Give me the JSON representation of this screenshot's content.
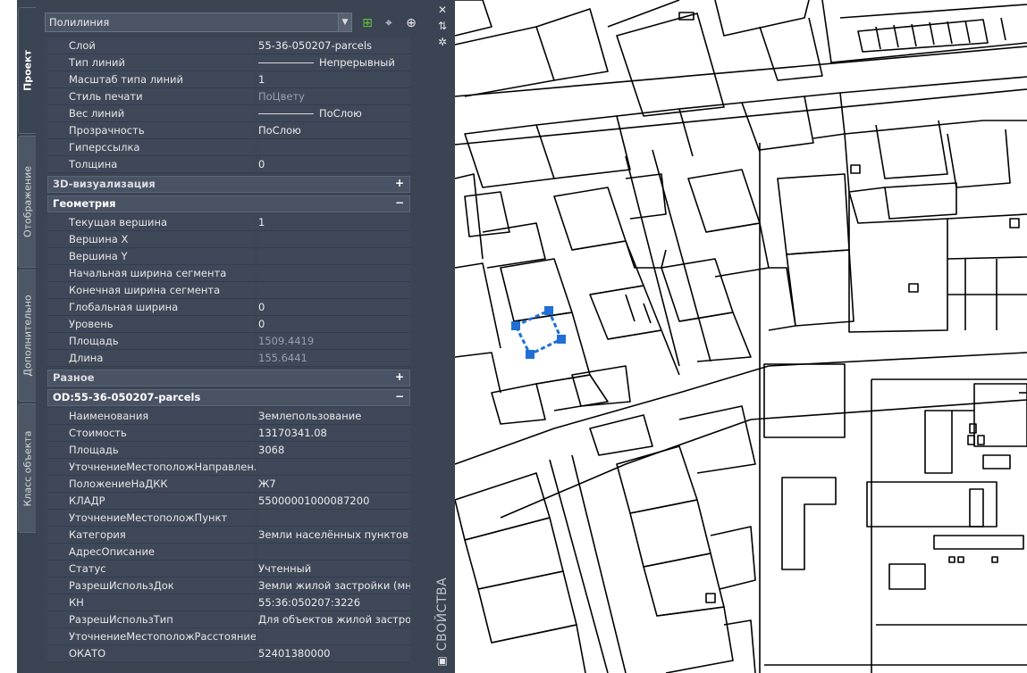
{
  "object_type": "Полилиния",
  "side_tabs": [
    "Проект",
    "Отображение",
    "Дополнительно",
    "Класс объекта"
  ],
  "right_strip_title": "СВОЙСТВА",
  "icons": {
    "toolbar": [
      "quick-select-icon",
      "select-objects-icon",
      "toggle-pickadd-icon"
    ],
    "strip": [
      "close-icon",
      "auto-hide-icon",
      "settings-icon",
      "properties-icon"
    ]
  },
  "colors": {
    "palette_bg": "#3b4453",
    "selection": "#1f6fd6"
  },
  "sections": [
    {
      "title": "",
      "expanded": true,
      "rows": [
        {
          "label": "Слой",
          "value": "55-36-050207-parcels"
        },
        {
          "label": "Тип линий",
          "value": "Непрерывный",
          "line": true
        },
        {
          "label": "Масштаб типа линий",
          "value": "1"
        },
        {
          "label": "Стиль печати",
          "value": "ПоЦвету",
          "gray": true
        },
        {
          "label": "Вес линий",
          "value": "ПоСлою",
          "line": true
        },
        {
          "label": "Прозрачность",
          "value": "ПоСлою"
        },
        {
          "label": "Гиперссылка",
          "value": ""
        },
        {
          "label": "Толщина",
          "value": "0"
        }
      ]
    },
    {
      "title": "3D-визуализация",
      "expanded": false,
      "sign": "+",
      "rows": []
    },
    {
      "title": "Геометрия",
      "expanded": true,
      "sign": "−",
      "rows": [
        {
          "label": "Текущая вершина",
          "value": "1"
        },
        {
          "label": "Вершина X",
          "value": ""
        },
        {
          "label": "Вершина Y",
          "value": ""
        },
        {
          "label": "Начальная ширина сегмента",
          "value": ""
        },
        {
          "label": "Конечная ширина сегмента",
          "value": ""
        },
        {
          "label": "Глобальная ширина",
          "value": "0"
        },
        {
          "label": "Уровень",
          "value": "0"
        },
        {
          "label": "Площадь",
          "value": "1509.4419",
          "gray": true
        },
        {
          "label": "Длина",
          "value": "155.6441",
          "gray": true
        }
      ]
    },
    {
      "title": "Разное",
      "expanded": false,
      "sign": "+",
      "rows": []
    },
    {
      "title": "OD:55-36-050207-parcels",
      "expanded": true,
      "sign": "−",
      "rows": [
        {
          "label": "Наименования",
          "value": "Землепользование"
        },
        {
          "label": "Стоимость",
          "value": "13170341.08"
        },
        {
          "label": "Площадь",
          "value": "3068"
        },
        {
          "label": "УточнениеМестоположНаправлен...",
          "value": ""
        },
        {
          "label": "ПоложениеНаДКК",
          "value": "Ж7"
        },
        {
          "label": "КЛАДР",
          "value": "55000001000087200"
        },
        {
          "label": "УточнениеМестоположПункт",
          "value": ""
        },
        {
          "label": "Категория",
          "value": "Земли населённых пунктов"
        },
        {
          "label": "АдресОписание",
          "value": ""
        },
        {
          "label": "Статус",
          "value": "Учтенный"
        },
        {
          "label": "РазрешИспользДок",
          "value": "Земли жилой застройки (мн..."
        },
        {
          "label": "КН",
          "value": "55:36:050207:3226"
        },
        {
          "label": "РазрешИспользТип",
          "value": "Для объектов жилой застро..."
        },
        {
          "label": "УточнениеМестоположРасстояние",
          "value": ""
        },
        {
          "label": "ОКАТО",
          "value": "52401380000"
        }
      ]
    }
  ]
}
